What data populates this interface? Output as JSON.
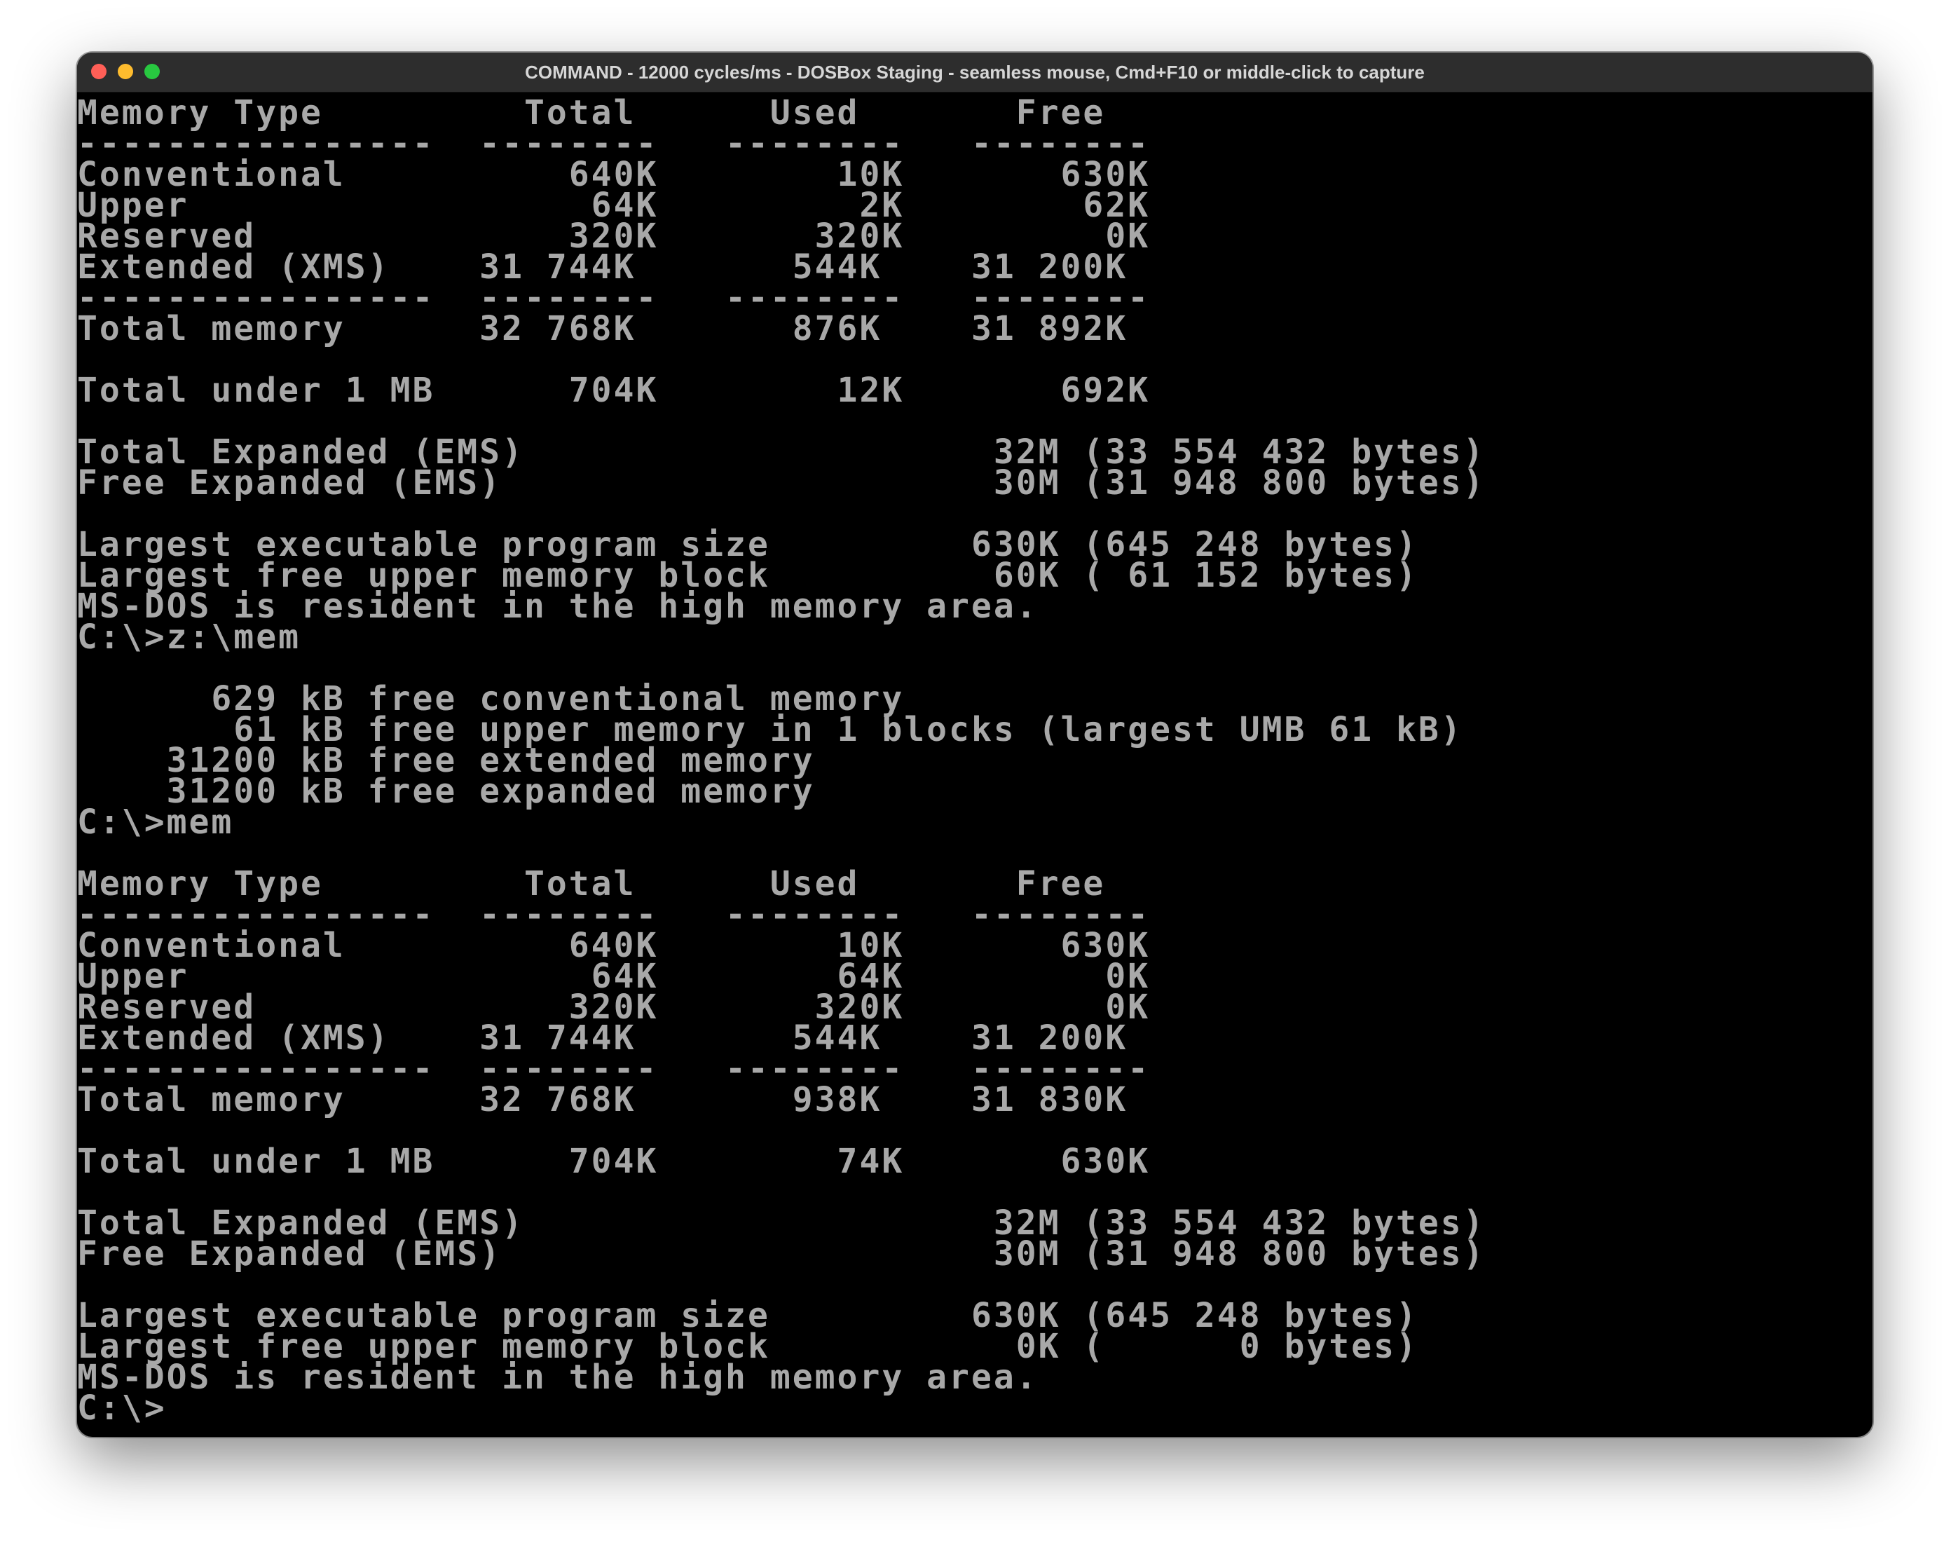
{
  "window": {
    "title": "COMMAND - 12000 cycles/ms - DOSBox Staging - seamless mouse, Cmd+F10 or middle-click to capture"
  },
  "colors": {
    "terminal_bg": "#000000",
    "terminal_fg": "#a8a8a8",
    "titlebar_bg": "#2d2d2d",
    "close": "#ff5f57",
    "minimize": "#febc2e",
    "maximize": "#28c840"
  },
  "terminal": {
    "lines": [
      "Memory Type         Total      Used       Free",
      "----------------  --------   --------   --------",
      "Conventional          640K        10K       630K",
      "Upper                  64K         2K        62K",
      "Reserved              320K       320K         0K",
      "Extended (XMS)    31 744K       544K    31 200K",
      "----------------  --------   --------   --------",
      "Total memory      32 768K       876K    31 892K",
      "",
      "Total under 1 MB      704K        12K       692K",
      "",
      "Total Expanded (EMS)                     32M (33 554 432 bytes)",
      "Free Expanded (EMS)                      30M (31 948 800 bytes)",
      "",
      "Largest executable program size         630K (645 248 bytes)",
      "Largest free upper memory block          60K ( 61 152 bytes)",
      "MS-DOS is resident in the high memory area.",
      "C:\\>z:\\mem",
      "",
      "      629 kB free conventional memory",
      "       61 kB free upper memory in 1 blocks (largest UMB 61 kB)",
      "    31200 kB free extended memory",
      "    31200 kB free expanded memory",
      "C:\\>mem",
      "",
      "Memory Type         Total      Used       Free",
      "----------------  --------   --------   --------",
      "Conventional          640K        10K       630K",
      "Upper                  64K        64K         0K",
      "Reserved              320K       320K         0K",
      "Extended (XMS)    31 744K       544K    31 200K",
      "----------------  --------   --------   --------",
      "Total memory      32 768K       938K    31 830K",
      "",
      "Total under 1 MB      704K        74K       630K",
      "",
      "Total Expanded (EMS)                     32M (33 554 432 bytes)",
      "Free Expanded (EMS)                      30M (31 948 800 bytes)",
      "",
      "Largest executable program size         630K (645 248 bytes)",
      "Largest free upper memory block           0K (      0 bytes)",
      "MS-DOS is resident in the high memory area.",
      "C:\\>"
    ]
  }
}
